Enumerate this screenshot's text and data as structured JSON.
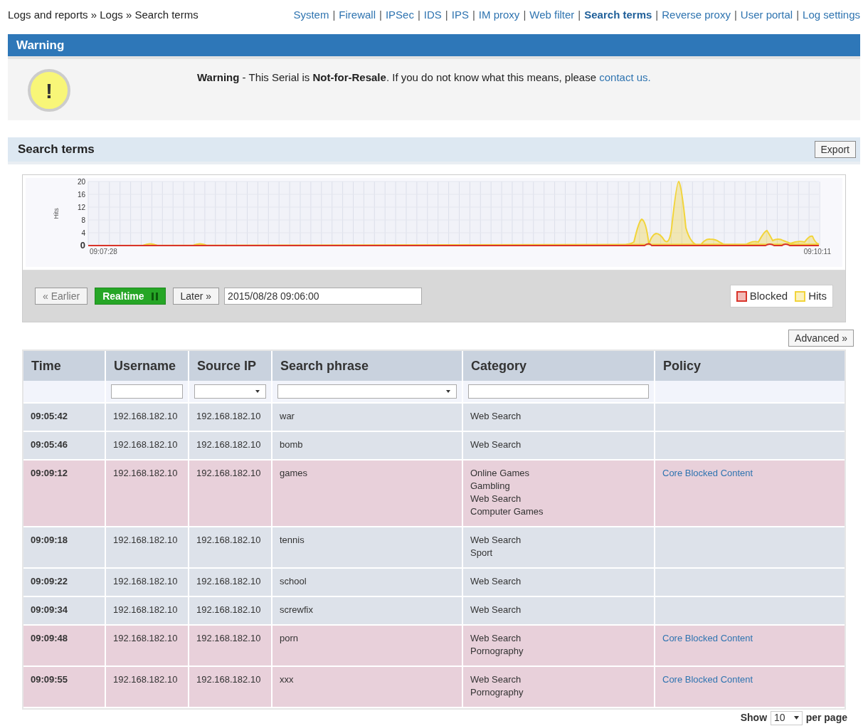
{
  "breadcrumb": "Logs and reports » Logs » Search terms",
  "nav": [
    {
      "label": "System",
      "selected": false
    },
    {
      "label": "Firewall",
      "selected": false
    },
    {
      "label": "IPSec",
      "selected": false
    },
    {
      "label": "IDS",
      "selected": false
    },
    {
      "label": "IPS",
      "selected": false
    },
    {
      "label": "IM proxy",
      "selected": false
    },
    {
      "label": "Web filter",
      "selected": false
    },
    {
      "label": "Search terms",
      "selected": true
    },
    {
      "label": "Reverse proxy",
      "selected": false
    },
    {
      "label": "User portal",
      "selected": false
    },
    {
      "label": "Log settings",
      "selected": false
    }
  ],
  "nav_separator": "|",
  "warning": {
    "title": "Warning",
    "icon_glyph": "!",
    "message": "**Warning** - This Serial is **Not-for-Resale**. If you do not know what this means, please",
    "link": "contact us."
  },
  "panel": {
    "title": "Search terms",
    "export_button": "Export"
  },
  "chart": {
    "ylabel": "Hits",
    "yticks": [
      "20",
      "16",
      "12",
      "8",
      "4",
      "0"
    ],
    "x_start": "09:07:28",
    "x_end": "09:10:11",
    "legend": [
      {
        "label": "Blocked",
        "color": "#d9342b"
      },
      {
        "label": "Hits",
        "color": "#f2d43a"
      }
    ]
  },
  "controls": {
    "earlier": "« Earlier",
    "realtime": "Realtime",
    "later": "Later »",
    "date": "2015/08/28 09:06:00"
  },
  "advanced_button": "Advanced »",
  "table": {
    "columns": [
      {
        "label": "Time",
        "kind": "plain"
      },
      {
        "label": "Username",
        "kind": "text"
      },
      {
        "label": "Source IP",
        "kind": "select"
      },
      {
        "label": "Search phrase",
        "kind": "select"
      },
      {
        "label": "Category",
        "kind": "text"
      },
      {
        "label": "Policy",
        "kind": "plain"
      }
    ],
    "rows": [
      {
        "time": "09:05:42",
        "username": "192.168.182.10",
        "source_ip": "192.168.182.10",
        "phrase": "war",
        "categories": [
          "Web Search"
        ],
        "blocked": false
      },
      {
        "time": "09:05:46",
        "username": "192.168.182.10",
        "source_ip": "192.168.182.10",
        "phrase": "bomb",
        "categories": [
          "Web Search"
        ],
        "blocked": false
      },
      {
        "time": "09:09:12",
        "username": "192.168.182.10",
        "source_ip": "192.168.182.10",
        "phrase": "games",
        "categories": [
          "Online Games",
          "Gambling",
          "Web Search",
          "Computer Games"
        ],
        "policy": "Core Blocked Content",
        "blocked": true
      },
      {
        "time": "09:09:18",
        "username": "192.168.182.10",
        "source_ip": "192.168.182.10",
        "phrase": "tennis",
        "categories": [
          "Web Search",
          "Sport"
        ],
        "blocked": false
      },
      {
        "time": "09:09:22",
        "username": "192.168.182.10",
        "source_ip": "192.168.182.10",
        "phrase": "school",
        "categories": [
          "Web Search"
        ],
        "blocked": false
      },
      {
        "time": "09:09:34",
        "username": "192.168.182.10",
        "source_ip": "192.168.182.10",
        "phrase": "screwfix",
        "categories": [
          "Web Search"
        ],
        "blocked": false
      },
      {
        "time": "09:09:48",
        "username": "192.168.182.10",
        "source_ip": "192.168.182.10",
        "phrase": "porn",
        "categories": [
          "Web Search",
          "Pornography"
        ],
        "policy": "Core Blocked Content",
        "blocked": true
      },
      {
        "time": "09:09:55",
        "username": "192.168.182.10",
        "source_ip": "192.168.182.10",
        "phrase": "xxx",
        "categories": [
          "Web Search",
          "Pornography"
        ],
        "policy": "Core Blocked Content",
        "blocked": true
      }
    ]
  },
  "pager": {
    "show": "Show",
    "value": "10",
    "per_page": "per page"
  }
}
